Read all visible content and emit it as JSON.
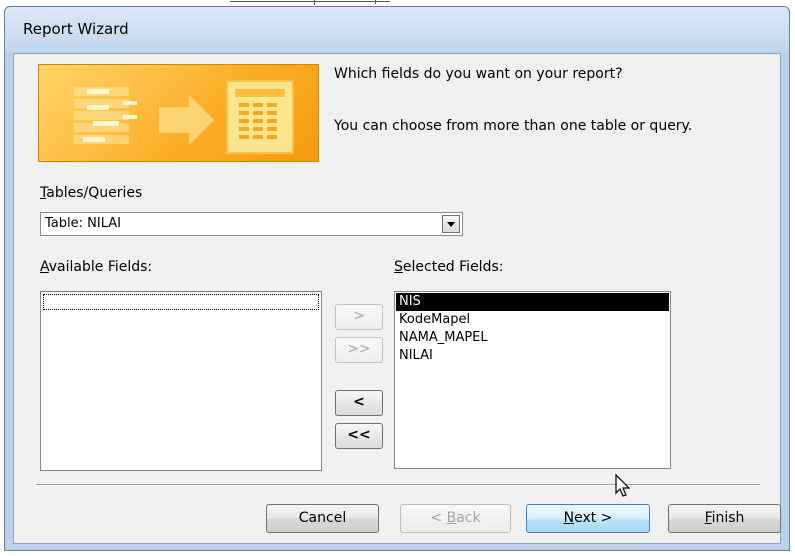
{
  "window": {
    "title": "Report Wizard"
  },
  "header": {
    "question": "Which fields do you want on your report?",
    "hint": "You can choose from more than one table or query.",
    "banner_icon": "report-wizard-banner-icon"
  },
  "tables_queries": {
    "label_key": "T",
    "label_rest": "ables/Queries",
    "value": "Table: NILAI"
  },
  "available_fields": {
    "label_key": "A",
    "label_rest": "vailable Fields:",
    "items": []
  },
  "selected_fields": {
    "label_key": "S",
    "label_rest": "elected Fields:",
    "items": [
      "NIS",
      "KodeMapel",
      "NAMA_MAPEL",
      "NILAI"
    ],
    "selected_index": 0
  },
  "move_buttons": {
    "add_one": ">",
    "add_all": ">>",
    "remove_one": "<",
    "remove_all": "<<"
  },
  "footer": {
    "cancel": "Cancel",
    "back_pre": "< ",
    "back_key": "B",
    "back_rest": "ack",
    "next_key": "N",
    "next_rest": "ext >",
    "finish_key": "F",
    "finish_rest": "inish"
  },
  "colors": {
    "titlebar": "#c8dcf0",
    "banner": "#fbb02a",
    "selection": "#000000",
    "default_button": "#3c7fb1"
  }
}
